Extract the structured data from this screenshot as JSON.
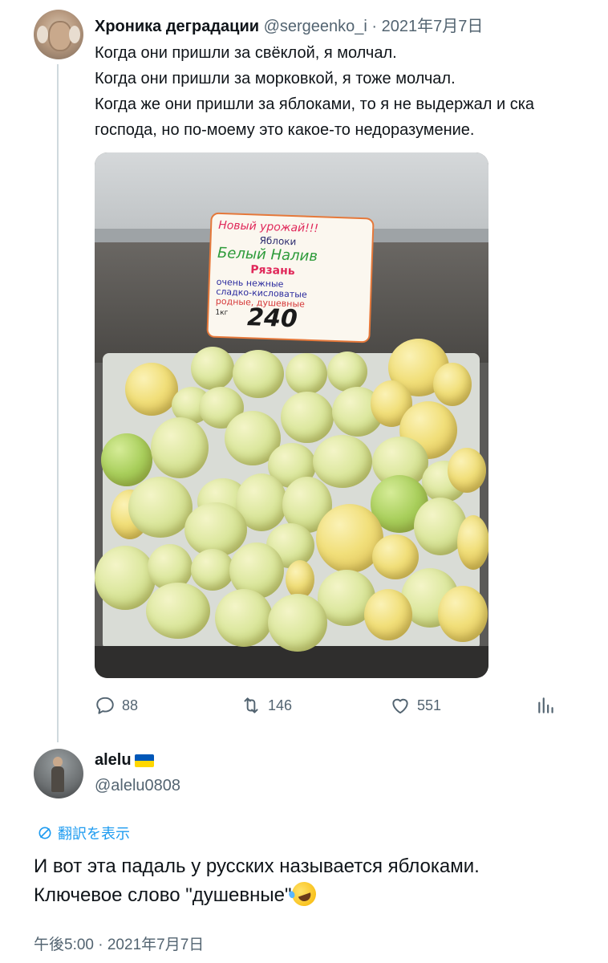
{
  "tweet": {
    "author_name": "Хроника деградации",
    "author_handle": "@sergeenko_i",
    "date_sep": " · ",
    "date": "2021年7月7日",
    "lines": [
      "Когда они пришли за свёклой, я молчал.",
      "Когда они пришли за морковкой, я тоже молчал.",
      "Когда же они пришли за яблоками, то я не выдержал и ска",
      "господа, но по-моему это какое-то недоразумение."
    ],
    "price_tag": {
      "line1": "Новый урожай!!!",
      "line2": "Яблоки",
      "line3": "Белый Налив",
      "line4": "Рязань",
      "line5": "очень нежные",
      "line6": "сладко-кисловатые",
      "line7": "родные, душевные",
      "line8": "1кг",
      "price": "240"
    },
    "stats": {
      "replies": "88",
      "retweets": "146",
      "likes": "551"
    },
    "icons": {
      "reply": "reply-icon",
      "retweet": "retweet-icon",
      "like": "like-icon",
      "stats": "stats-icon"
    }
  },
  "reply": {
    "author_name": "alelu",
    "author_handle": "@alelu0808",
    "translate_label": "翻訳を表示",
    "lines": [
      "И вот эта падаль у русских называется яблоками.",
      "Ключевое слово \"душевные\""
    ],
    "timestamp": "午後5:00 · 2021年7月7日"
  },
  "colors": {
    "link": "#1d9bf0",
    "secondary_text": "#536471",
    "primary_text": "#0f1419"
  }
}
